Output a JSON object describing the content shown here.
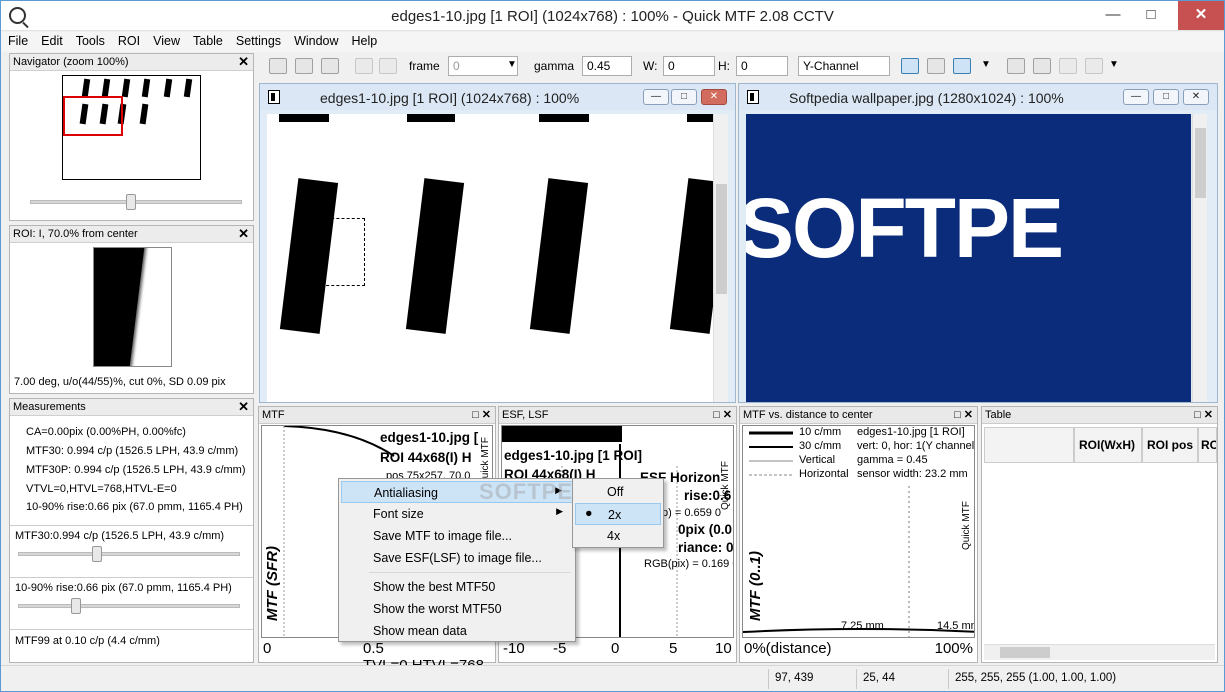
{
  "window": {
    "title": "edges1-10.jpg [1 ROI] (1024x768) : 100% - Quick MTF 2.08 CCTV",
    "close_label": "✕"
  },
  "menu": [
    "File",
    "Edit",
    "Tools",
    "ROI",
    "View",
    "Table",
    "Settings",
    "Window",
    "Help"
  ],
  "navigator": {
    "title": "Navigator (zoom 100%)",
    "close": "✕"
  },
  "roi_panel": {
    "title": "ROI: I, 70.0% from center",
    "info": "7.00 deg, u/o(44/55)%, cut 0%, SD 0.09 pix",
    "close": "✕"
  },
  "measurements": {
    "title": "Measurements",
    "close": "✕",
    "lines": [
      "CA=0.00pix (0.00%PH, 0.00%fc)",
      "MTF30: 0.994 c/p (1526.5 LPH, 43.9 c/mm)",
      "MTF30P: 0.994 c/p (1526.5 LPH, 43.9 c/mm)",
      "VTVL=0,HTVL=768,HTVL-E=0",
      "10-90% rise:0.66 pix (67.0 pmm, 1165.4 PH)"
    ],
    "sliders": [
      {
        "label": "MTF30:0.994 c/p (1526.5 LPH, 43.9 c/mm)",
        "level": 0.35
      },
      {
        "label": "10-90% rise:0.66 pix (67.0 pmm, 1165.4 PH)",
        "level": 0.25
      },
      {
        "label": "MTF99 at 0.10 c/p (4.4 c/mm)"
      }
    ]
  },
  "toolbar": {
    "frame_label": "frame",
    "frame_value": "0",
    "gamma_label": "gamma",
    "gamma_value": "0.45",
    "w_label": "W:",
    "w_value": "0",
    "h_label": "H:",
    "h_value": "0",
    "channel": "Y-Channel"
  },
  "doc1": {
    "title": "edges1-10.jpg [1 ROI] (1024x768) : 100%"
  },
  "doc2": {
    "title": "Softpedia wallpaper.jpg (1280x1024) : 100%",
    "logo_text": "SOFTPE"
  },
  "mtf_panel": {
    "title": "MTF",
    "ylabel": "MTF (SFR)",
    "info_line1": "edges1-10.jpg [",
    "info_line2": "ROI 44x68(I) H",
    "info_line3": "pos 75x257, 70.0",
    "side_label": "Quick MTF",
    "x_start": "0",
    "x_end": "0.5 TVL=0,HTVL=768"
  },
  "esf_panel": {
    "title": "ESF, LSF",
    "info_line1": "edges1-10.jpg [1 ROI]",
    "info_line2": "ROI 44x68(I) H",
    "info_line3": "ESF Horizon",
    "info_line4": "rise:0.6",
    "info_line5": "p) = 0.659 0",
    "info_line6": "0pix (0.0",
    "info_line7": "riance: 0",
    "info_line8": "RGB(pix) = 0.169 0",
    "side_label": "Quick MTF",
    "ticks": [
      "-10",
      "-5",
      "0",
      "5",
      "10"
    ]
  },
  "dist_panel": {
    "title": "MTF vs. distance to center",
    "legend": [
      "10 c/mm",
      "30 c/mm",
      "Vertical",
      "Horizontal"
    ],
    "info": [
      "edges1-10.jpg [1 ROI]",
      "vert: 0, hor: 1(Y channel)",
      "gamma = 0.45",
      "sensor width: 23.2 mm"
    ],
    "ylabel": "MTF (0..1)",
    "side_label": "Quick MTF",
    "mark1": "7.25 mm",
    "mark2": "14.5 mm",
    "x_start": "0%(distance)",
    "x_end": "100%"
  },
  "table_panel": {
    "title": "Table",
    "columns": [
      "ROI(WxH)",
      "ROI pos",
      "RO"
    ]
  },
  "context_menu": {
    "items": [
      "Antialiasing",
      "Font size",
      "Save MTF to image file...",
      "Save ESF(LSF) to image file...",
      "Show the best MTF50",
      "Show the worst MTF50",
      "Show mean data"
    ],
    "submenu": [
      "Off",
      "2x",
      "4x"
    ],
    "selected": "2x",
    "watermark": "SOFTPEDIA"
  },
  "status": {
    "cell1": "97, 439",
    "cell2": "25, 44",
    "cell3": "255, 255, 255 (1.00, 1.00, 1.00)"
  }
}
